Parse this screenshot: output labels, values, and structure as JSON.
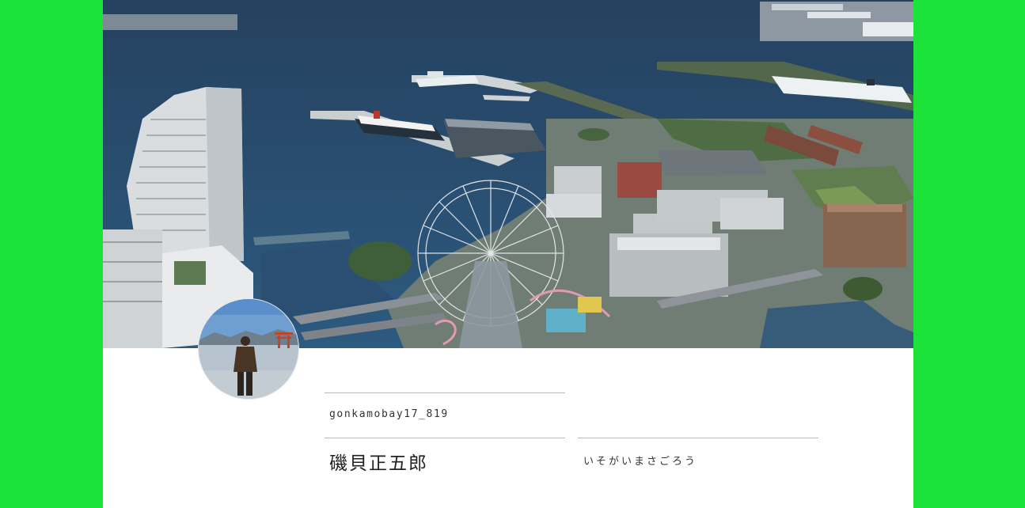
{
  "page": {
    "background_color": "#1be33a",
    "card_color": "#ffffff"
  },
  "cover_photo": {
    "description_icon": "harbor-cityscape-photo"
  },
  "profile": {
    "avatar_icon": "person-by-water-photo",
    "handle": "gonkamobay17_819",
    "name": "磯貝正五郎",
    "name_reading": "いそがいまさごろう"
  }
}
